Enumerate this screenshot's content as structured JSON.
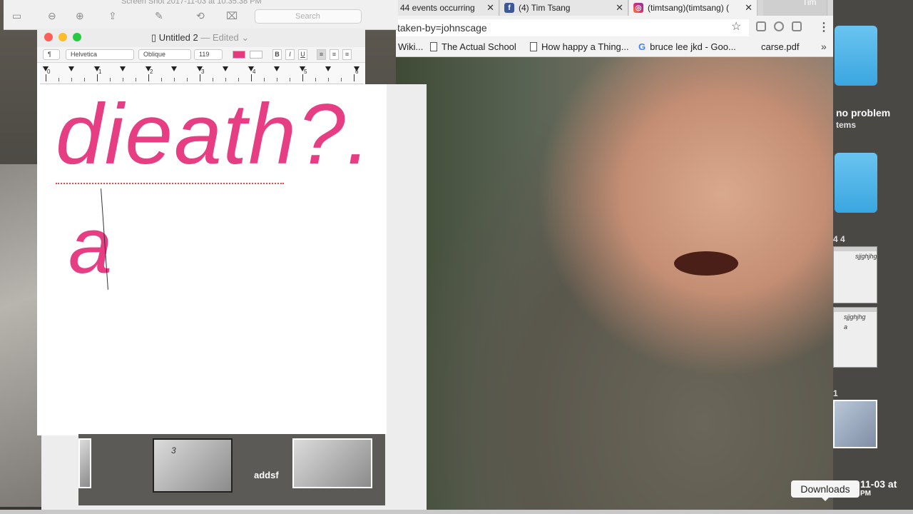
{
  "chrome": {
    "tabs": [
      {
        "label": "44 events occurring",
        "favicon": "",
        "close": "✕"
      },
      {
        "label": "(4) Tim Tsang",
        "favicon": "facebook-icon",
        "close": "✕"
      },
      {
        "label": "(timtsang)(timtsang) (",
        "favicon": "instagram-icon",
        "close": "✕"
      }
    ],
    "profile_name": "Tim",
    "url": "taken-by=johnscage",
    "bookmarks": [
      {
        "label": "Wiki...",
        "icon": ""
      },
      {
        "label": "The Actual School",
        "icon": "document-icon"
      },
      {
        "label": "How happy a Thing...",
        "icon": "document-icon"
      },
      {
        "label": "bruce lee jkd - Goo...",
        "icon": "google-icon"
      },
      {
        "label": "carse.pdf",
        "icon": ""
      }
    ],
    "more": "»"
  },
  "preview": {
    "title": "Screen Shot 2017-11-03 at 10.35.38 PM",
    "search_placeholder": "Search"
  },
  "textedit": {
    "title": "Untitled 2",
    "edited": "— Edited ⌄",
    "font_family": "Helvetica",
    "font_style": "Oblique",
    "font_size": "119",
    "paragraph": "¶",
    "bold": "B",
    "italic": "I",
    "underline": "U",
    "text_color": "#e63d83",
    "ruler_numbers": [
      "0",
      "1",
      "2",
      "3",
      "4",
      "5",
      "6"
    ],
    "line1": "dieath?.",
    "line2": "a"
  },
  "desktop": {
    "folder_label": "no problem",
    "folder_sub": "tems",
    "label_44": "4 4",
    "thumb1_text": "sjjghjhg",
    "thumb2_text": "sjjghjhg",
    "thumb2_line2": "a",
    "label_1": "1",
    "dock_label": "addsf",
    "dock_thumb_number": "3",
    "downloads_tooltip": "Downloads",
    "date_text_1": "11-03 at",
    "date_text_2": "PM"
  }
}
